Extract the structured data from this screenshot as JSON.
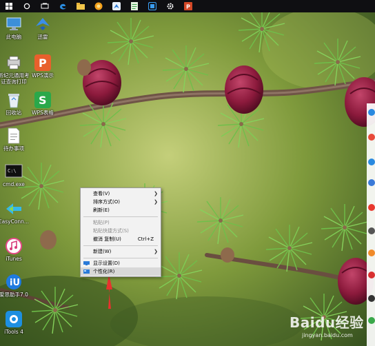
{
  "taskbar": {
    "items": [
      {
        "icon": "windows-logo-icon"
      },
      {
        "icon": "cortana-circle-icon"
      },
      {
        "icon": "task-view-icon"
      },
      {
        "icon": "edge-browser-icon"
      },
      {
        "icon": "file-explorer-icon"
      },
      {
        "icon": "app-orange-icon"
      },
      {
        "icon": "app-blue-bird-icon"
      },
      {
        "icon": "app-green-notepad-icon"
      },
      {
        "icon": "app-blue-square-icon"
      },
      {
        "icon": "settings-gear-icon"
      },
      {
        "icon": "powerpoint-icon"
      }
    ]
  },
  "desktop_icons": [
    {
      "label": "此电脑",
      "icon": "computer-icon"
    },
    {
      "label": "迅雷",
      "icon": "thunder-bird-icon"
    },
    {
      "label": "新纪元通用考\n证查询打印",
      "icon": "printer-icon"
    },
    {
      "label": "WPS演示",
      "icon": "wps-presentation-icon"
    },
    {
      "label": "回收站",
      "icon": "recycle-bin-icon"
    },
    {
      "label": "WPS表格",
      "icon": "wps-spreadsheet-icon"
    },
    {
      "label": "待办事项",
      "icon": "todo-document-icon"
    },
    {
      "label": "cmd.exe",
      "icon": "cmd-console-icon"
    },
    {
      "label": "EasyConn...",
      "icon": "easyconnect-icon"
    },
    {
      "label": "iTunes",
      "icon": "itunes-icon"
    },
    {
      "label": "爱思助手7.0",
      "icon": "aisi-assistant-icon"
    },
    {
      "label": "iTools 4",
      "icon": "itools-icon"
    }
  ],
  "context_menu": {
    "items": [
      {
        "label": "查看(V)",
        "submenu": true,
        "disabled": false
      },
      {
        "label": "排序方式(O)",
        "submenu": true,
        "disabled": false
      },
      {
        "label": "刷新(E)",
        "submenu": false,
        "disabled": false
      },
      {
        "label": "粘贴(P)",
        "submenu": false,
        "disabled": true
      },
      {
        "label": "粘贴快捷方式(S)",
        "submenu": false,
        "disabled": true
      },
      {
        "label": "撤消 复制(U)",
        "shortcut": "Ctrl+Z",
        "submenu": false,
        "disabled": false
      },
      {
        "label": "新建(W)",
        "submenu": true,
        "disabled": false
      },
      {
        "label": "显示设置(D)",
        "icon": "display-settings-icon",
        "disabled": false
      },
      {
        "label": "个性化(R)",
        "icon": "personalize-icon",
        "disabled": false,
        "highlighted": true
      }
    ]
  },
  "watermark": {
    "brand": "Baidu经验",
    "url": "jingyan.baidu.com"
  },
  "colors": {
    "taskbar_bg": "#0f0f12",
    "menu_bg": "#f2f2f2",
    "menu_highlight": "#d8d8d8",
    "arrow_red": "#e8322e",
    "flower": "#8c1a3c",
    "branch": "#7a5a4a"
  }
}
